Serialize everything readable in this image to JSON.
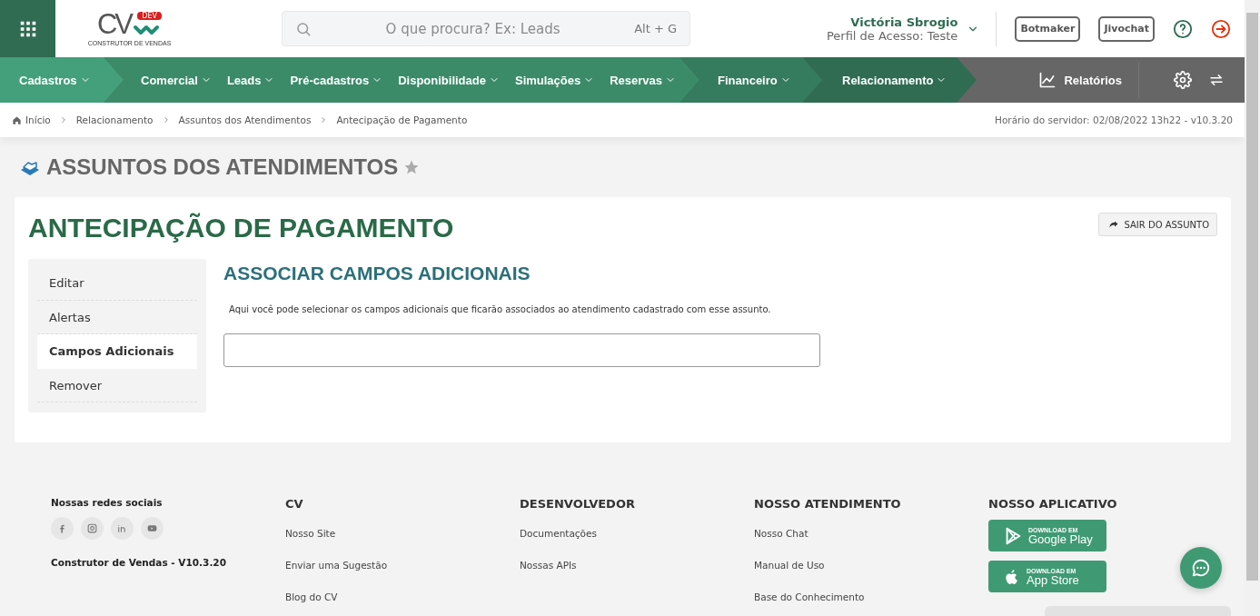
{
  "header": {
    "logo": {
      "letters": "CV",
      "badge": "DEV",
      "tagline": "CONSTRUTOR DE VENDAS"
    },
    "search": {
      "placeholder": "O que procura? Ex: Leads",
      "shortcut": "Alt + G"
    },
    "user": {
      "name": "Victória Sbrogio",
      "profile": "Perfil de Acesso: Teste"
    },
    "buttons": [
      "Botmaker",
      "Jivochat"
    ]
  },
  "nav": {
    "groups": [
      {
        "color": "#44a07a",
        "items": [
          "Cadastros"
        ]
      },
      {
        "color": "#3b8b69",
        "items": [
          "Comercial",
          "Leads",
          "Pré-cadastros",
          "Disponibilidade",
          "Simulações",
          "Reservas"
        ]
      },
      {
        "color": "#357b5d",
        "items": [
          "Financeiro"
        ]
      },
      {
        "color": "#2f6c51",
        "items": [
          "Relacionamento"
        ]
      }
    ],
    "reports": "Relatórios"
  },
  "breadcrumb": {
    "items": [
      "Início",
      "Relacionamento",
      "Assuntos dos Atendimentos",
      "Antecipação de Pagamento"
    ],
    "server_time": "Horário do servidor: 02/08/2022 13h22 - v10.3.20"
  },
  "page": {
    "title": "ASSUNTOS DOS ATENDIMENTOS",
    "favorite": false,
    "subject": "ANTECIPAÇÃO DE PAGAMENTO",
    "exit_button": "SAIR DO ASSUNTO",
    "menu": [
      {
        "label": "Editar",
        "selected": false
      },
      {
        "label": "Alertas",
        "selected": false
      },
      {
        "label": "Campos Adicionais",
        "selected": true
      },
      {
        "label": "Remover",
        "selected": false
      }
    ],
    "section_title": "ASSOCIAR CAMPOS ADICIONAIS",
    "description": "Aqui você pode selecionar os campos adicionais que ficarão associados ao atendimento cadastrado com esse assunto."
  },
  "footer": {
    "social_title": "Nossas redes sociais",
    "version": "Construtor de Vendas - V10.3.20",
    "columns": [
      {
        "title": "CV",
        "links": [
          "Nosso Site",
          "Enviar uma Sugestão",
          "Blog do CV"
        ]
      },
      {
        "title": "DESENVOLVEDOR",
        "links": [
          "Documentações",
          "Nossas APIs"
        ]
      },
      {
        "title": "NOSSO ATENDIMENTO",
        "links": [
          "Nosso Chat",
          "Manual de Uso",
          "Base do Conhecimento"
        ]
      }
    ],
    "app_title": "NOSSO APLICATIVO",
    "stores": [
      {
        "kind": "google",
        "small": "DOWNLOAD EM",
        "big": "Google Play"
      },
      {
        "kind": "apple",
        "small": "DOWNLOAD EM",
        "big": "App Store"
      }
    ]
  }
}
